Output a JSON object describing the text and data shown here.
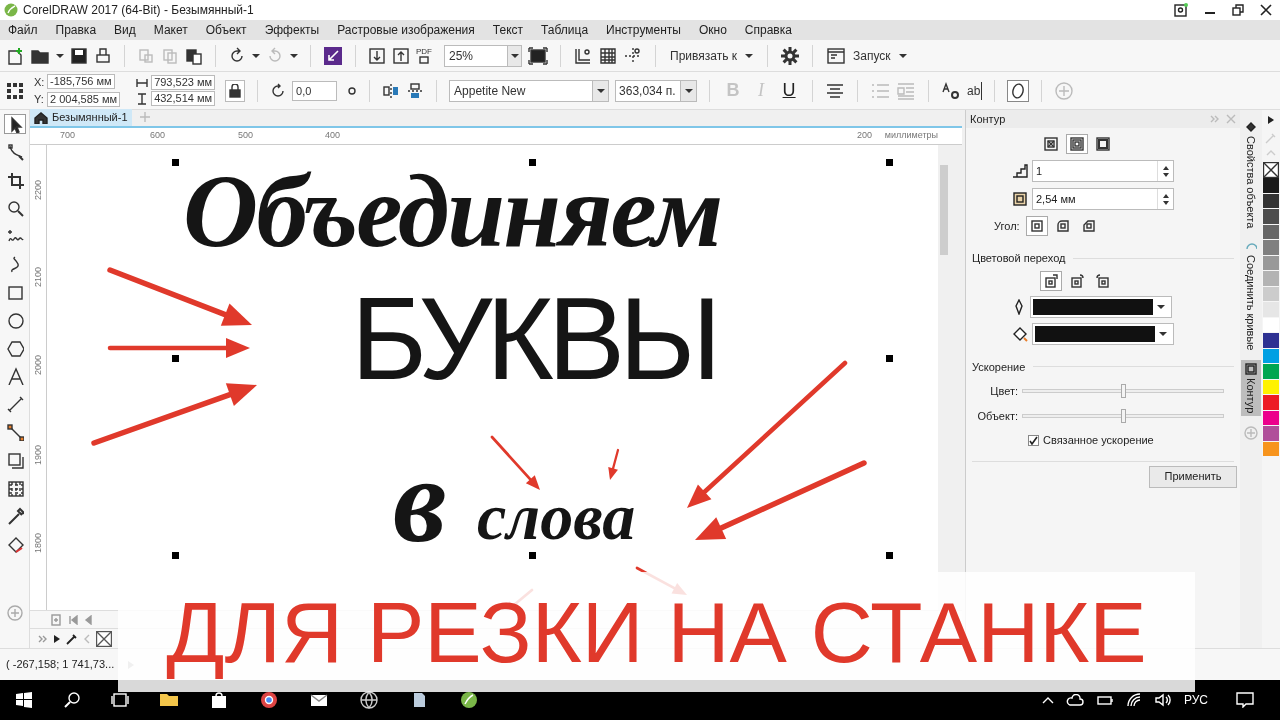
{
  "window": {
    "title": "CorelDRAW 2017 (64-Bit) - Безымянный-1"
  },
  "menu": [
    "Файл",
    "Правка",
    "Вид",
    "Макет",
    "Объект",
    "Эффекты",
    "Растровые изображения",
    "Текст",
    "Таблица",
    "Инструменты",
    "Окно",
    "Справка"
  ],
  "toolbar": {
    "pdf_label": "PDF",
    "zoom": "25%",
    "snap": "Привязать к",
    "launch": "Запуск"
  },
  "property_bar": {
    "x_label": "X:",
    "x": "-185,756 мм",
    "y_label": "Y:",
    "y": "2 004,585 мм",
    "width": "793,523 мм",
    "height": "432,514 мм",
    "rotation": "0,0",
    "font": "Appetite New",
    "font_size": "363,034 п.",
    "format_buttons": [
      {
        "label": "B",
        "disabled": true
      },
      {
        "label": "I",
        "disabled": true
      },
      {
        "label": "U",
        "disabled": false
      }
    ],
    "text_label": "ab"
  },
  "toolbox": [
    {
      "selected": true
    },
    {
      "selected": false
    },
    {
      "selected": false
    },
    {
      "selected": false
    },
    {
      "selected": false
    },
    {
      "selected": false
    },
    {
      "selected": false
    },
    {
      "selected": false
    },
    {
      "selected": false
    },
    {
      "selected": false
    },
    {
      "selected": false
    },
    {
      "selected": false
    },
    {
      "selected": false
    },
    {
      "selected": false
    },
    {
      "selected": false
    },
    {
      "selected": false
    }
  ],
  "document_tab": {
    "label": "Безымянный-1",
    "selected": true
  },
  "ruler": {
    "horizontal": [
      "700",
      "600",
      "500",
      "400",
      "200"
    ],
    "units": "миллиметры",
    "vertical": [
      "2200",
      "2100",
      "2000",
      "1900",
      "1800"
    ]
  },
  "canvas": {
    "texts": [
      {
        "kind": "serif",
        "text": "Объединяем"
      },
      {
        "kind": "sans",
        "text": "БУКВЫ"
      },
      {
        "kind": "serif",
        "text": "в"
      },
      {
        "kind": "script",
        "text": "слова"
      }
    ]
  },
  "docker": {
    "title": "Контур",
    "position_buttons": [
      {
        "selected": false
      },
      {
        "selected": true
      },
      {
        "selected": false
      }
    ],
    "steps": "1",
    "offset": "2,54 мм",
    "corner_label": "Угол:",
    "corner_buttons": [
      {
        "selected": true
      },
      {
        "selected": false
      },
      {
        "selected": false
      }
    ],
    "blend_heading": "Цветовой переход",
    "blend_buttons": [
      {
        "selected": true
      },
      {
        "selected": false
      },
      {
        "selected": false
      }
    ],
    "acceleration_heading": "Ускорение",
    "sliders": [
      {
        "label": "Цвет:",
        "level": 0.5
      },
      {
        "label": "Объект:",
        "level": 0.5
      }
    ],
    "linked": {
      "label": "Связанное ускорение",
      "checked": true
    },
    "apply": "Применить"
  },
  "side_tabs": [
    {
      "label": "Свойства объекта",
      "selected": false
    },
    {
      "label": "Соединить кривые",
      "selected": false
    },
    {
      "label": "Контур",
      "selected": true
    }
  ],
  "palette": [
    {
      "color": "#1a1a1a"
    },
    {
      "color": "#333333"
    },
    {
      "color": "#4d4d4d"
    },
    {
      "color": "#666666"
    },
    {
      "color": "#808080"
    },
    {
      "color": "#999999"
    },
    {
      "color": "#b3b3b3"
    },
    {
      "color": "#cccccc"
    },
    {
      "color": "#e6e6e6"
    },
    {
      "color": "#ffffff"
    },
    {
      "color": "#2e3192"
    },
    {
      "color": "#00a0e3"
    },
    {
      "color": "#00a651"
    },
    {
      "color": "#fff200"
    },
    {
      "color": "#ed1c24"
    },
    {
      "color": "#ec008c"
    },
    {
      "color": "#b04f9a"
    },
    {
      "color": "#f7941d"
    }
  ],
  "status_bar": {
    "coordinates": "( -267,158; 1 741,73..."
  },
  "taskbar": {
    "language": "РУС"
  },
  "caption": "ДЛЯ РЕЗКИ НА СТАНКЕ"
}
